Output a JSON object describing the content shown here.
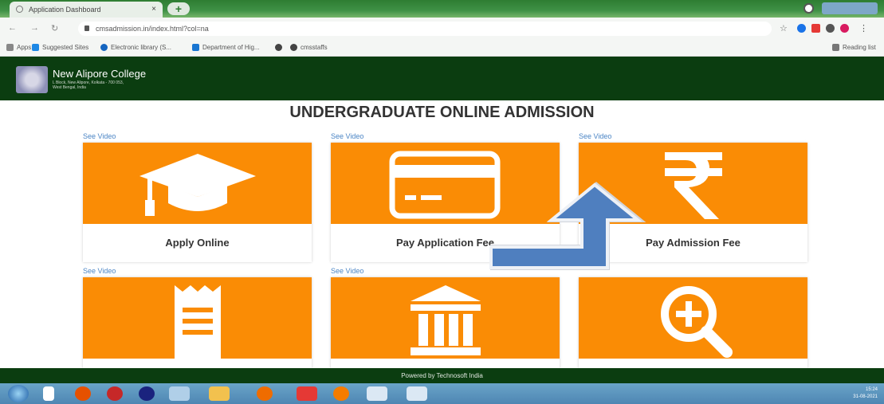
{
  "browser": {
    "tab_title": "Application Dashboard",
    "tab_close": "×",
    "new_tab": "+",
    "url": "cmsadmission.in/index.html?col=na",
    "bookmarks": [
      "Apps",
      "Suggested Sites",
      "Electronic library (S...",
      "Department of Hig...",
      "cmsstaffs"
    ],
    "reading_list": "Reading list"
  },
  "site": {
    "college_name": "New Alipore College",
    "college_address": "L Block, New Alipore, Kolkata - 700 053, West Bengal, India",
    "page_title": "UNDERGRADUATE ONLINE ADMISSION"
  },
  "cards": [
    {
      "see_video": "See Video",
      "label": "Apply Online",
      "icon": "graduation-cap-icon"
    },
    {
      "see_video": "See Video",
      "label": "Pay Application Fee",
      "icon": "credit-card-icon"
    },
    {
      "see_video": "See Video",
      "label": "Pay Admission Fee",
      "icon": "rupee-icon"
    },
    {
      "see_video": "See Video",
      "label": "",
      "icon": "receipt-icon"
    },
    {
      "see_video": "See Video",
      "label": "",
      "icon": "bank-icon"
    },
    {
      "see_video": "",
      "label": "",
      "icon": "zoom-in-icon"
    }
  ],
  "footer": {
    "text": "Powered by Technosoft India"
  },
  "taskbar": {
    "time": "15:24",
    "date": "31-08-2021"
  },
  "colors": {
    "tile": "#fa8c05",
    "header": "#0b3d10",
    "link": "#4b85c5",
    "arrow": "#4f7fbf"
  }
}
